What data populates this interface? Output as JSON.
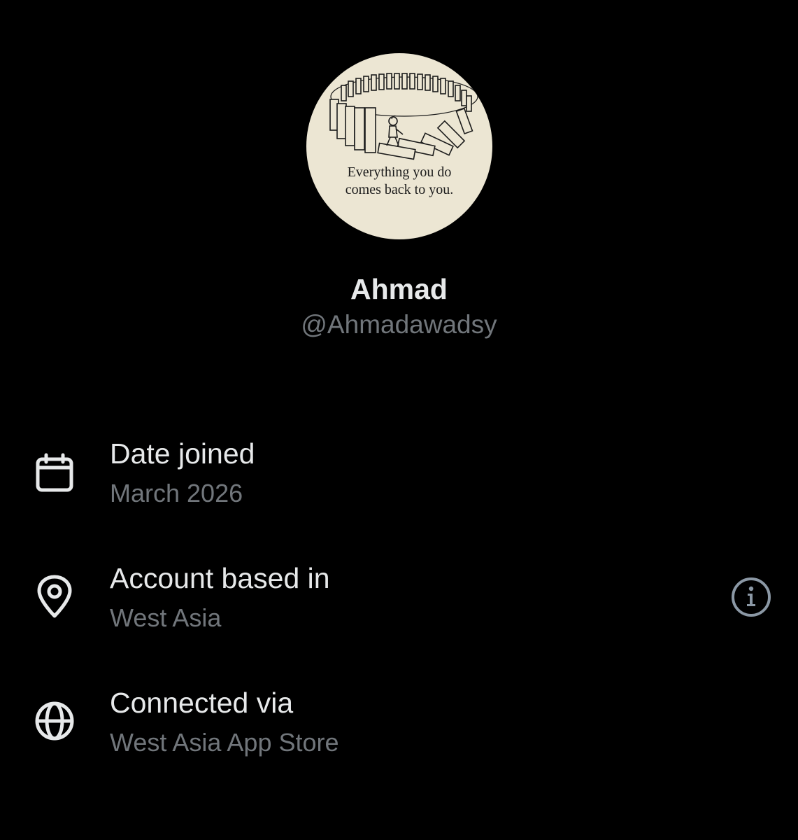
{
  "profile": {
    "avatar_caption_line1": "Everything you do",
    "avatar_caption_line2": "comes back to you.",
    "name": "Ahmad",
    "handle": "@Ahmadawadsy"
  },
  "about": {
    "date_joined": {
      "label": "Date joined",
      "value": "March 2026",
      "icon": "calendar-icon"
    },
    "account_based_in": {
      "label": "Account based in",
      "value": "West Asia",
      "icon": "location-pin-icon",
      "info_icon": "info-icon"
    },
    "connected_via": {
      "label": "Connected via",
      "value": "West Asia App Store",
      "icon": "globe-icon"
    }
  },
  "colors": {
    "background": "#000000",
    "primary_text": "#e7e9ea",
    "secondary_text": "#71767b",
    "avatar_background": "#ece6d3"
  }
}
